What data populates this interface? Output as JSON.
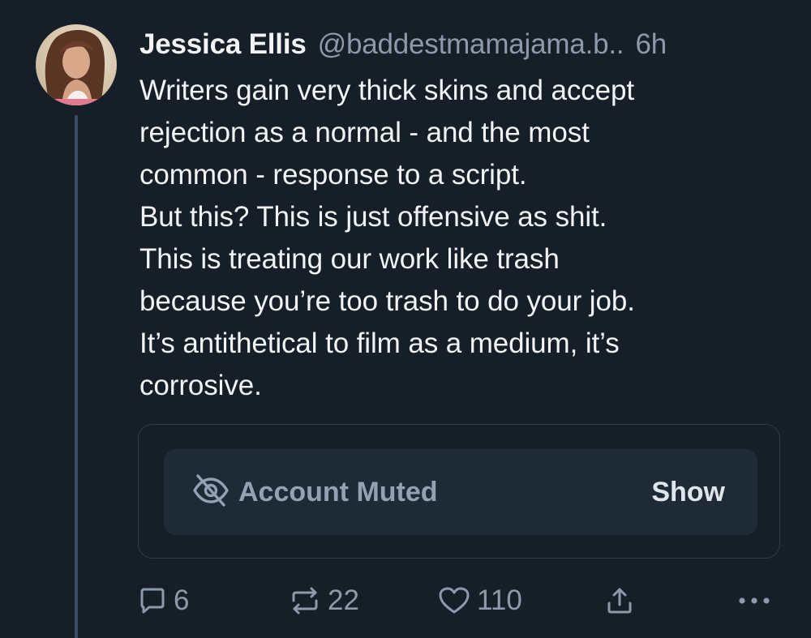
{
  "post": {
    "display_name": "Jessica Ellis",
    "handle": "@baddestmamajama.b..",
    "time": "6h",
    "text": "Writers gain very thick skins and accept\nrejection as a normal - and the most\ncommon - response to a script.\nBut this? This is just offensive as shit.\nThis is treating our work like trash\nbecause you’re too trash to do your job.\nIt’s antithetical to film as a medium, it’s\ncorrosive.",
    "avatar_icon": "profile-photo"
  },
  "embed": {
    "muted_icon": "eye-slash-icon",
    "muted_label": "Account Muted",
    "show_label": "Show"
  },
  "actions": {
    "reply_icon": "comment-icon",
    "reply_count": "6",
    "repost_icon": "repost-icon",
    "repost_count": "22",
    "like_icon": "heart-icon",
    "like_count": "110",
    "share_icon": "share-icon",
    "more_icon": "ellipsis-icon"
  },
  "colors": {
    "background": "#161e27",
    "text": "#f1f3f5",
    "muted_text": "#8c9aab",
    "thread_line": "#3a4f66",
    "muted_box": "#1e2a36"
  }
}
